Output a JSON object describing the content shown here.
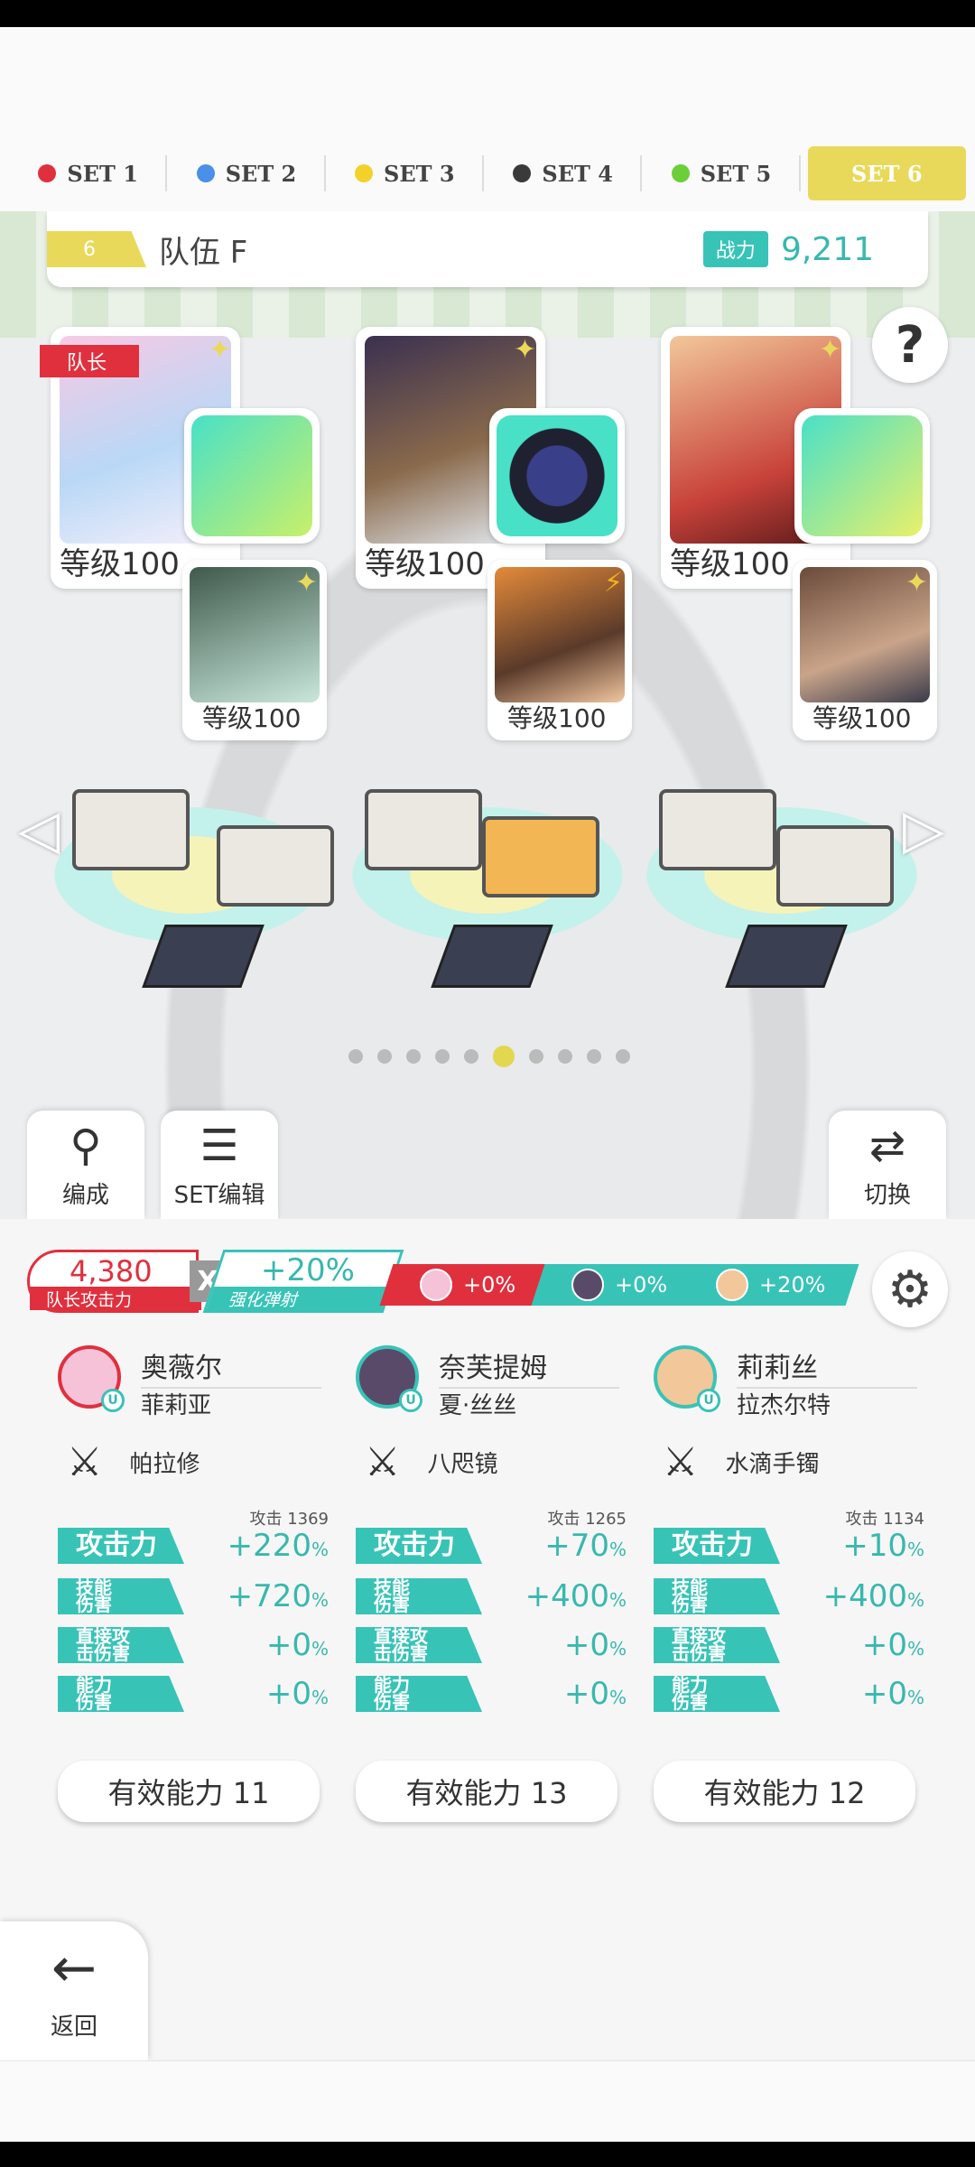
{
  "set_tabs": [
    {
      "label": "SET 1",
      "color": "#e0303e"
    },
    {
      "label": "SET 2",
      "color": "#4a8fe8"
    },
    {
      "label": "SET 3",
      "color": "#f2d22a"
    },
    {
      "label": "SET 4",
      "color": "#3a3a3a"
    },
    {
      "label": "SET 5",
      "color": "#6ccf3a"
    },
    {
      "label": "SET 6",
      "color": "#e9d95a",
      "active": true
    }
  ],
  "team": {
    "number": "6",
    "name": "队伍 F",
    "power_label": "战力",
    "power_value": "9,211"
  },
  "help_icon": "?",
  "leader_badge": "队长",
  "heroes": [
    {
      "level": "等级100",
      "sub_level": "等级100"
    },
    {
      "level": "等级100",
      "sub_level": "等级100"
    },
    {
      "level": "等级100",
      "sub_level": "等级100"
    }
  ],
  "actions": {
    "formation": "编成",
    "set_edit": "SET编辑",
    "switch": "切换"
  },
  "summary": {
    "leader_attack": "4,380",
    "leader_attack_label": "队长攻击力",
    "multiply": "X",
    "boost_value": "+20%",
    "boost_label": "强化弹射",
    "chips": [
      "+0%",
      "+0%",
      "+20%"
    ]
  },
  "columns": [
    {
      "name1": "奥薇尔",
      "name2": "菲莉亚",
      "gear": "帕拉修",
      "stats": [
        {
          "label": "攻击力",
          "raw": "攻击 1369",
          "value": "+220",
          "unit": "%"
        },
        {
          "label": "技能\n伤害",
          "value": "+720",
          "unit": "%"
        },
        {
          "label": "直接攻\n击伤害",
          "value": "+0",
          "unit": "%"
        },
        {
          "label": "能力\n伤害",
          "value": "+0",
          "unit": "%"
        }
      ],
      "effective": "有效能力 11"
    },
    {
      "name1": "奈芙提姆",
      "name2": "夏·丝丝",
      "gear": "八咫镜",
      "stats": [
        {
          "label": "攻击力",
          "raw": "攻击 1265",
          "value": "+70",
          "unit": "%"
        },
        {
          "label": "技能\n伤害",
          "value": "+400",
          "unit": "%"
        },
        {
          "label": "直接攻\n击伤害",
          "value": "+0",
          "unit": "%"
        },
        {
          "label": "能力\n伤害",
          "value": "+0",
          "unit": "%"
        }
      ],
      "effective": "有效能力 13"
    },
    {
      "name1": "莉莉丝",
      "name2": "拉杰尔特",
      "gear": "水滴手镯",
      "stats": [
        {
          "label": "攻击力",
          "raw": "攻击 1134",
          "value": "+10",
          "unit": "%"
        },
        {
          "label": "技能\n伤害",
          "value": "+400",
          "unit": "%"
        },
        {
          "label": "直接攻\n击伤害",
          "value": "+0",
          "unit": "%"
        },
        {
          "label": "能力\n伤害",
          "value": "+0",
          "unit": "%"
        }
      ],
      "effective": "有效能力 12"
    }
  ],
  "back_label": "返回",
  "page_dots": {
    "total": 10,
    "active": 6
  }
}
